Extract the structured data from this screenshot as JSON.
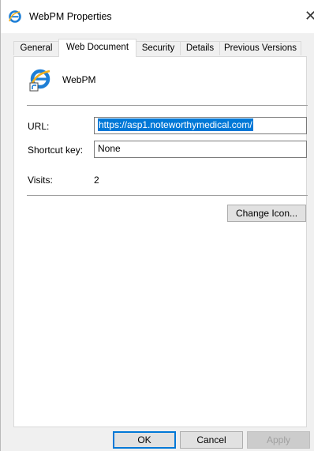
{
  "window": {
    "title": "WebPM Properties",
    "close_glyph": "✕"
  },
  "tabs": [
    {
      "label": "General",
      "active": false
    },
    {
      "label": "Web Document",
      "active": true
    },
    {
      "label": "Security",
      "active": false
    },
    {
      "label": "Details",
      "active": false
    },
    {
      "label": "Previous Versions",
      "active": false
    }
  ],
  "document": {
    "name": "WebPM",
    "icon": "internet-explorer-shortcut-icon"
  },
  "fields": {
    "url_label": "URL:",
    "url_value": "https://asp1.noteworthymedical.com/",
    "shortcut_label": "Shortcut key:",
    "shortcut_value": "None",
    "visits_label": "Visits:",
    "visits_value": "2"
  },
  "buttons": {
    "change_icon": "Change Icon...",
    "ok": "OK",
    "cancel": "Cancel",
    "apply": "Apply"
  },
  "colors": {
    "selection": "#0078d7",
    "ie_blue": "#1e7fd6",
    "ie_gold": "#f2b01e"
  }
}
